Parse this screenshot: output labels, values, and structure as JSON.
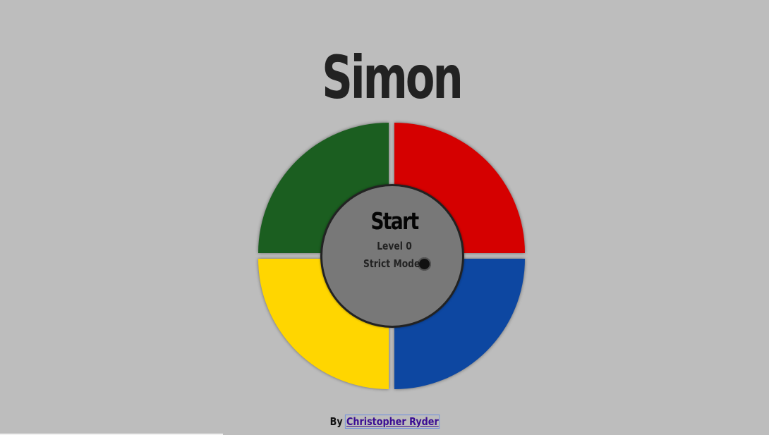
{
  "app": {
    "title": "Simon"
  },
  "board": {
    "pads": [
      {
        "color_name": "green",
        "color": "#1b5e20"
      },
      {
        "color_name": "red",
        "color": "#d50000"
      },
      {
        "color_name": "yellow",
        "color": "#ffd600"
      },
      {
        "color_name": "blue",
        "color": "#0d47a1"
      }
    ],
    "hub_color": "#787878"
  },
  "controls": {
    "start_label": "Start",
    "level_text": "Level 0",
    "strict_label": "Strict Mode",
    "strict_enabled": false
  },
  "footer": {
    "by_text": "By",
    "author_name": "Christopher Ryder",
    "link_color": "#3a0c93"
  },
  "colors": {
    "background": "#bdbdbd",
    "text": "#222222"
  }
}
